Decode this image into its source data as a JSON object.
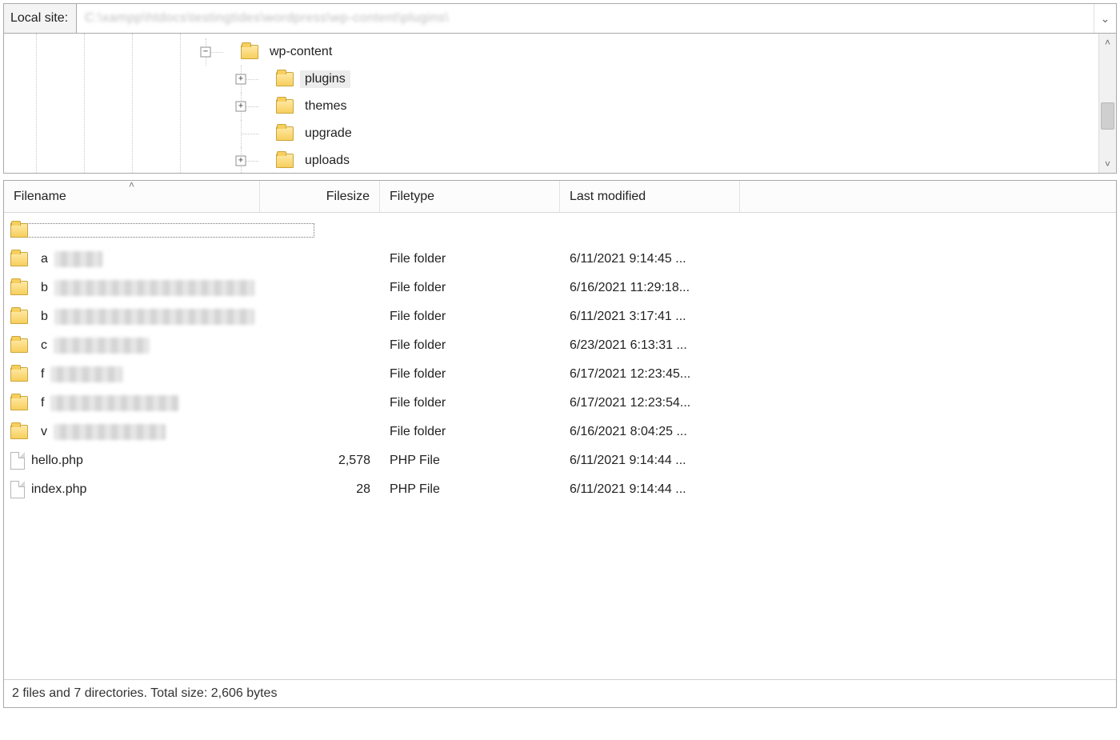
{
  "pathbar": {
    "label": "Local site:",
    "path_obscured": "C:\\xampp\\htdocs\\testingtides\\wordpress\\wp-content\\plugins\\"
  },
  "tree": {
    "root": {
      "label": "wp-content",
      "expanded": true,
      "children": [
        {
          "label": "plugins",
          "expandable": true,
          "selected": true
        },
        {
          "label": "themes",
          "expandable": true
        },
        {
          "label": "upgrade",
          "expandable": false
        },
        {
          "label": "uploads",
          "expandable": true
        }
      ]
    }
  },
  "columns": {
    "name": "Filename",
    "size": "Filesize",
    "type": "Filetype",
    "modified": "Last modified",
    "sort": "name_asc"
  },
  "rows": [
    {
      "kind": "parent",
      "name": "..",
      "size": "",
      "type": "",
      "modified": "",
      "name_obscured": true
    },
    {
      "kind": "folder",
      "name": "a",
      "size": "",
      "type": "File folder",
      "modified": "6/11/2021 9:14:45 ...",
      "name_obscured": true,
      "blur_w": 60
    },
    {
      "kind": "folder",
      "name": "b",
      "size": "",
      "type": "File folder",
      "modified": "6/16/2021 11:29:18...",
      "name_obscured": true,
      "blur_w": 250
    },
    {
      "kind": "folder",
      "name": "b",
      "size": "",
      "type": "File folder",
      "modified": "6/11/2021 3:17:41 ...",
      "name_obscured": true,
      "blur_w": 250
    },
    {
      "kind": "folder",
      "name": "c",
      "size": "",
      "type": "File folder",
      "modified": "6/23/2021 6:13:31 ...",
      "name_obscured": true,
      "blur_w": 120
    },
    {
      "kind": "folder",
      "name": "f",
      "size": "",
      "type": "File folder",
      "modified": "6/17/2021 12:23:45...",
      "name_obscured": true,
      "blur_w": 90
    },
    {
      "kind": "folder",
      "name": "f",
      "size": "",
      "type": "File folder",
      "modified": "6/17/2021 12:23:54...",
      "name_obscured": true,
      "blur_w": 160
    },
    {
      "kind": "folder",
      "name": "v",
      "size": "",
      "type": "File folder",
      "modified": "6/16/2021 8:04:25 ...",
      "name_obscured": true,
      "blur_w": 140
    },
    {
      "kind": "file",
      "name": "hello.php",
      "size": "2,578",
      "type": "PHP File",
      "modified": "6/11/2021 9:14:44 ..."
    },
    {
      "kind": "file",
      "name": "index.php",
      "size": "28",
      "type": "PHP File",
      "modified": "6/11/2021 9:14:44 ..."
    }
  ],
  "status": "2 files and 7 directories. Total size: 2,606 bytes"
}
